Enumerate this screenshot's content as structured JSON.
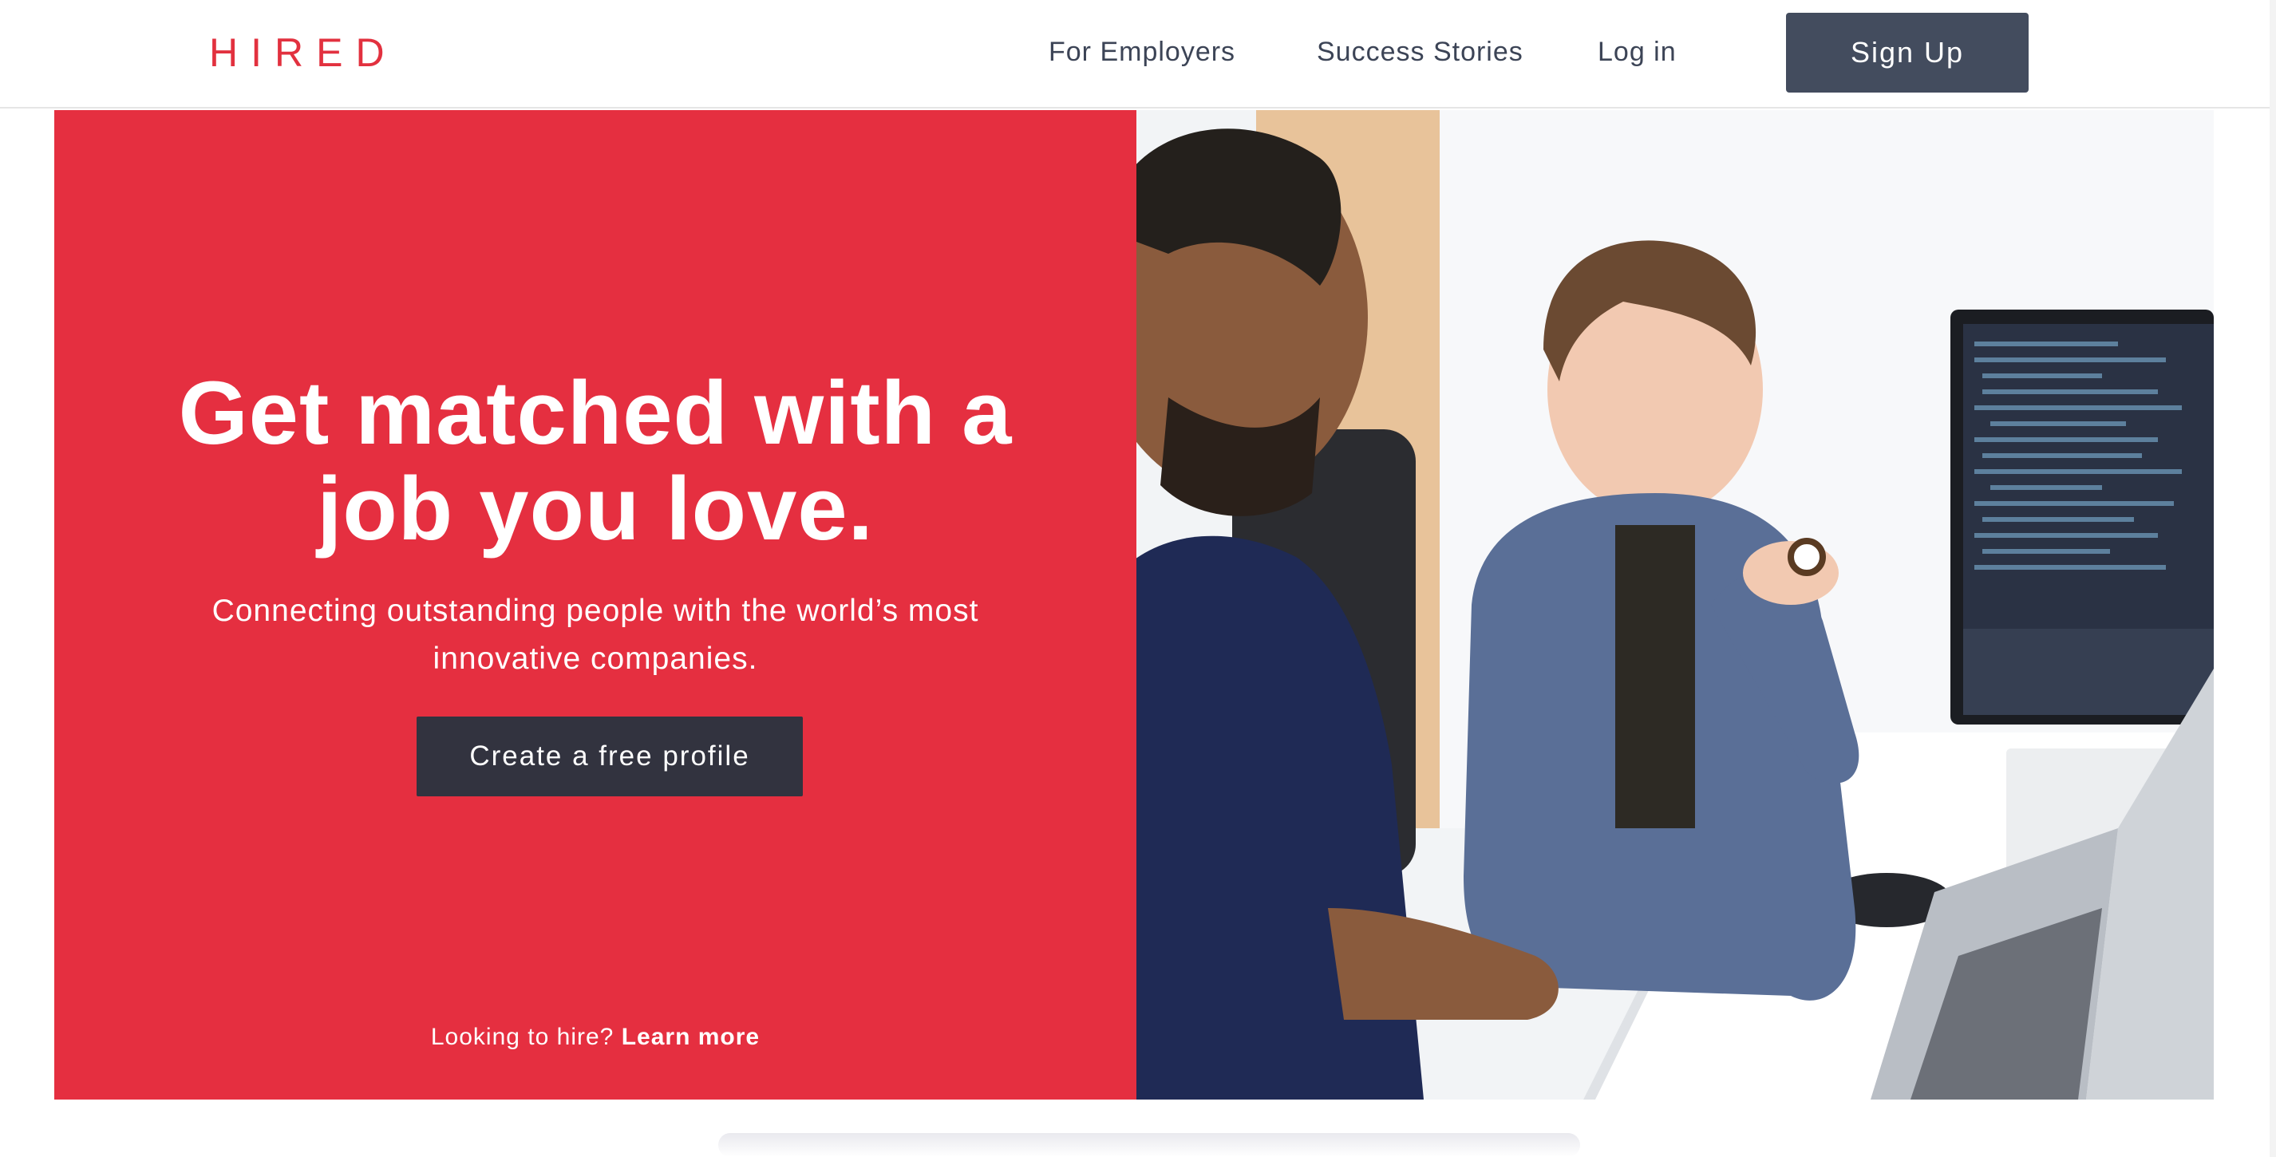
{
  "header": {
    "logo": "HIRED",
    "nav": {
      "employers": "For Employers",
      "success": "Success Stories",
      "login": "Log in"
    },
    "signup_label": "Sign Up"
  },
  "hero": {
    "headline_line1": "Get matched with a",
    "headline_line2": "job you love.",
    "sub_line1": "Connecting outstanding people with the world’s most",
    "sub_line2": "innovative companies.",
    "cta_label": "Create a free profile",
    "hire_prefix": "Looking to hire?",
    "hire_link": "Learn more"
  },
  "colors": {
    "brand_red": "#e52f40",
    "nav_text": "#3c4456",
    "signup_bg": "#434c5e",
    "cta_bg": "#32333f"
  }
}
